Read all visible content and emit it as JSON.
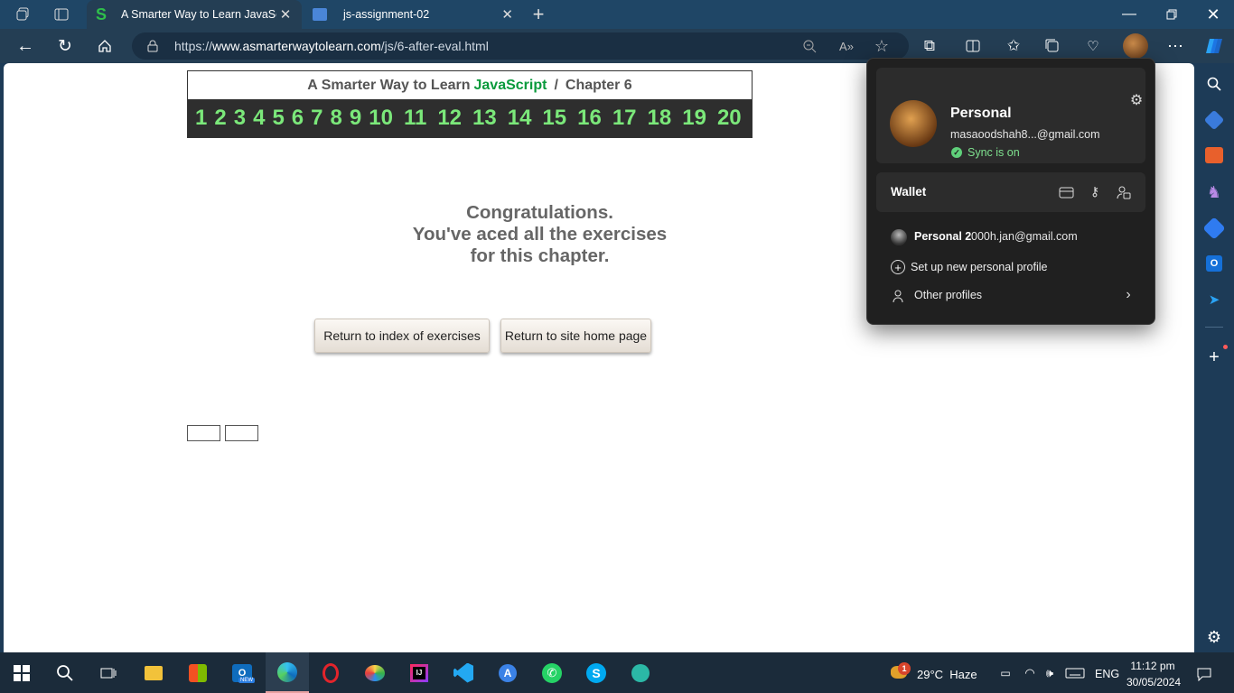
{
  "browser": {
    "tabs": [
      {
        "title": "A Smarter Way to Learn JavaScrip",
        "favicon": "S"
      },
      {
        "title": "js-assignment-02"
      }
    ],
    "address": {
      "scheme": "https://",
      "host": "www.asmarterwaytolearn.com",
      "path": "/js/6-after-eval.html"
    },
    "colors": {
      "accent": "#0a9a3c",
      "chapter_nums": "#7be87a"
    }
  },
  "page": {
    "header": {
      "prefix": "A Smarter Way to Learn",
      "highlight": "JavaScript",
      "sep": "/",
      "chapter": "Chapter 6"
    },
    "chapters": [
      "1",
      "2",
      "3",
      "4",
      "5",
      "6",
      "7",
      "8",
      "9",
      "10",
      "11",
      "12",
      "13",
      "14",
      "15",
      "16",
      "17",
      "18",
      "19",
      "20"
    ],
    "congrats": [
      "Congratulations.",
      "You've aced all the exercises",
      "for this chapter."
    ],
    "buttons": {
      "index": "Return to index of exercises",
      "home": "Return to site home page"
    }
  },
  "profile": {
    "name": "Personal",
    "email": "masaoodshah8...@gmail.com",
    "sync": "Sync is on",
    "wallet": "Wallet",
    "other_name": "Personal 2",
    "other_email": "000h.jan@gmail.com",
    "setup": "Set up new personal profile",
    "others": "Other profiles"
  },
  "taskbar": {
    "weather": "29°C  Haze",
    "lang": "ENG",
    "time": "11:12 pm",
    "date": "30/05/2024",
    "badge": "1",
    "outlook_badge": "NEW"
  }
}
